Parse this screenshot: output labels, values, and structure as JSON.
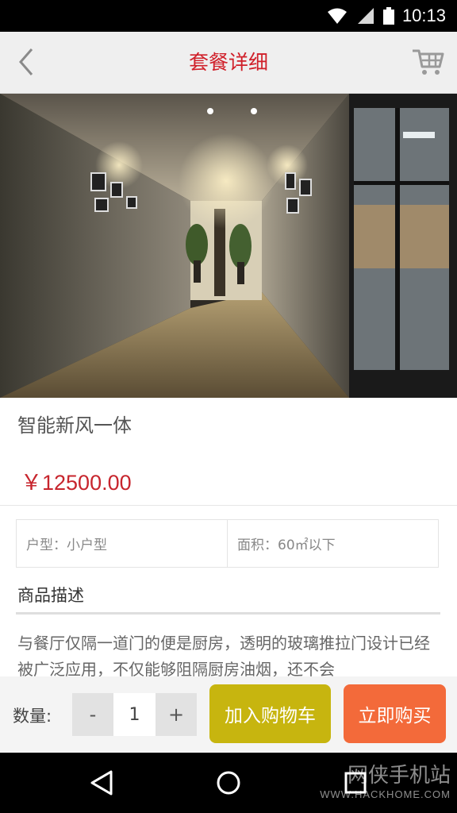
{
  "status_bar": {
    "time": "10:13"
  },
  "header": {
    "title": "套餐详细"
  },
  "product": {
    "name": "智能新风一体",
    "price": "￥12500.00",
    "specs": [
      {
        "text": "户型：小户型"
      },
      {
        "text": "面积：60㎡以下"
      }
    ],
    "description_title": "商品描述",
    "description": "与餐厅仅隔一道门的便是厨房，透明的玻璃推拉门设计已经被广泛应用，不仅能够阻隔厨房油烟，还不会"
  },
  "actions": {
    "qty_label": "数量:",
    "minus": "-",
    "qty": "1",
    "plus": "+",
    "add_to_cart": "加入购物车",
    "buy_now": "立即购买"
  },
  "watermark": {
    "name": "网侠手机站",
    "url": "WWW.HACKHOME.COM"
  },
  "colors": {
    "title_red": "#d0202a",
    "price_red": "#c7252d",
    "cart_button": "#c7b50f",
    "buy_button": "#f36a3a"
  },
  "icons": [
    "wifi-icon",
    "signal-icon",
    "battery-icon",
    "back-icon",
    "cart-icon",
    "nav-back-icon",
    "nav-home-icon",
    "nav-recents-icon"
  ]
}
